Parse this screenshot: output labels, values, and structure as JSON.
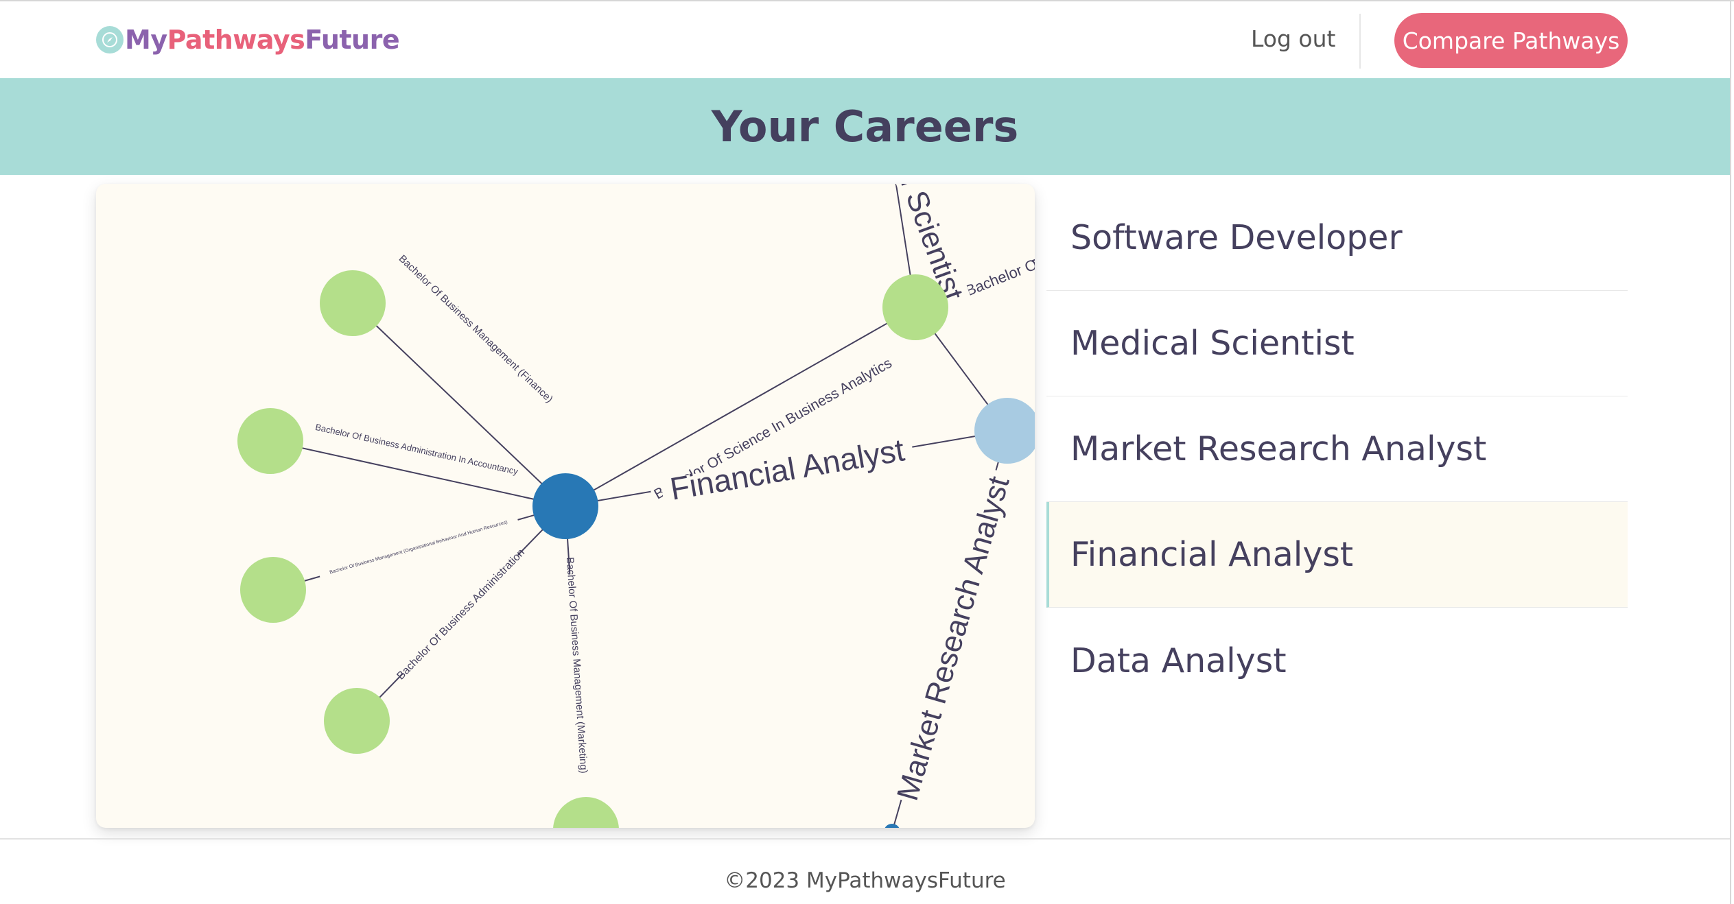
{
  "header": {
    "logo": {
      "my": "My",
      "pathways": "Pathways",
      "future": "Future"
    },
    "logout_label": "Log out",
    "compare_label": "Compare Pathways"
  },
  "banner": {
    "title": "Your Careers"
  },
  "graph": {
    "center_career": "Financial Analyst",
    "top_career": "al Scientist",
    "bottom_career": "Market Research Analyst",
    "degrees": [
      "Bachelor Of Business Management (Finance)",
      "Bachelor Of Business Administration In Accountancy",
      "Bachelor Of Business Management (Organisational Behaviour And Human Resources)",
      "Bachelor Of Business Administration",
      "Bachelor Of Business Management (Marketing)",
      "Bachelor Of Science In Business Analytics"
    ],
    "partial_degree": "Bachelor O",
    "colors": {
      "degree_node": "#b4df8a",
      "selected_career_node": "#2878b5",
      "other_career_node": "#a8cbe2",
      "link": "#45405e"
    }
  },
  "careers": {
    "items": [
      {
        "label": "Software Developer",
        "active": false
      },
      {
        "label": "Medical Scientist",
        "active": false
      },
      {
        "label": "Market Research Analyst",
        "active": false
      },
      {
        "label": "Financial Analyst",
        "active": true
      },
      {
        "label": "Data Analyst",
        "active": false
      }
    ]
  },
  "footer": {
    "text": "©2023 MyPathwaysFuture"
  },
  "colors": {
    "accent": "#a8dcd7",
    "brand_pink": "#e8677b",
    "brand_purple": "#8b62ad",
    "text_dark": "#45405e"
  }
}
